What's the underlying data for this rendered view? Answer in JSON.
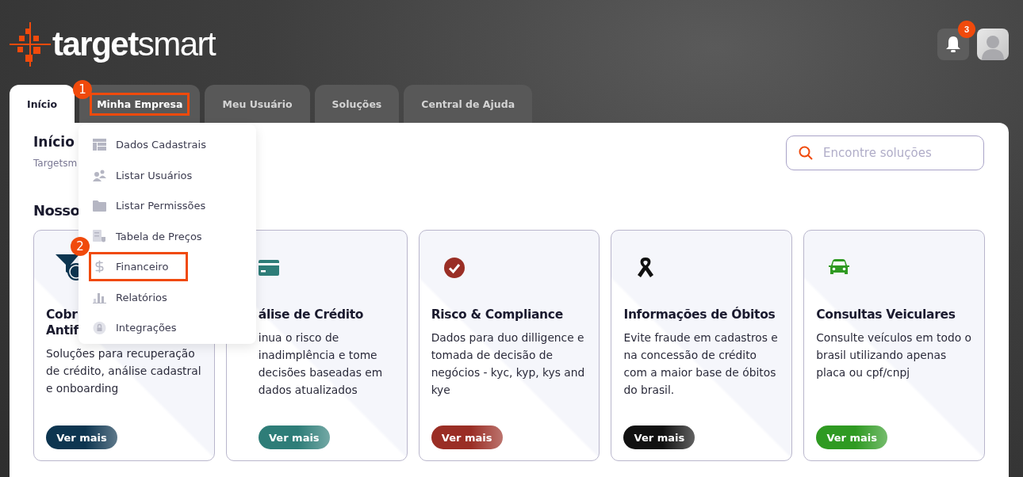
{
  "logo": {
    "bold": "target",
    "light": "smart"
  },
  "header": {
    "notifications": {
      "count": "3"
    }
  },
  "tabs": [
    {
      "label": "Início",
      "selected": true,
      "highlighted": false
    },
    {
      "label": "Minha Empresa",
      "selected": false,
      "highlighted": true,
      "marker": "1"
    },
    {
      "label": "Meu Usuário",
      "selected": false,
      "highlighted": false
    },
    {
      "label": "Soluções",
      "selected": false,
      "highlighted": false
    },
    {
      "label": "Central de Ajuda",
      "selected": false,
      "highlighted": false
    }
  ],
  "dropdown": {
    "items": [
      {
        "label": "Dados Cadastrais",
        "kind": "table",
        "highlighted": false
      },
      {
        "label": "Listar Usuários",
        "kind": "users",
        "highlighted": false
      },
      {
        "label": "Listar Permissões",
        "kind": "folder",
        "highlighted": false
      },
      {
        "label": "Tabela de Preços",
        "kind": "pricelist",
        "highlighted": false
      },
      {
        "label": "Financeiro",
        "kind": "dollar",
        "highlighted": true,
        "marker": "2"
      },
      {
        "label": "Relatórios",
        "kind": "chart",
        "highlighted": false
      },
      {
        "label": "Integrações",
        "kind": "lock",
        "highlighted": false
      }
    ]
  },
  "page": {
    "title": "Início",
    "breadcrumb": "Targetsm",
    "search": {
      "placeholder": "Encontre soluções"
    },
    "section_title": "Nosso"
  },
  "cards": [
    {
      "kind": "funnel",
      "title": [
        "Cobr",
        "Antif"
      ],
      "description": "Soluções para recuperação de crédito, análise cadastral e onboarding",
      "button": "Ver mais",
      "color": "#0d3550"
    },
    {
      "kind": "card",
      "title": [
        "álise de Crédito"
      ],
      "description": "inua o risco de inadimplência e tome decisões baseadas em dados atualizados",
      "button": "Ver mais",
      "color": "#2e7d78"
    },
    {
      "kind": "check",
      "title": [
        "Risco & Compliance"
      ],
      "description": "Dados para duo dilligence e tomada de decisão de negócios - kyc, kyp, kys and kye",
      "button": "Ver mais",
      "color": "#9a2e25"
    },
    {
      "kind": "ribbon",
      "title": [
        "Informações de Óbitos"
      ],
      "description": "Evite fraude em cadastros e na concessão de crédito com a maior base de óbitos do brasil.",
      "button": "Ver mais",
      "color": "#111111"
    },
    {
      "kind": "car",
      "title": [
        "Consultas Veiculares"
      ],
      "description": "Consulte veículos em todo o brasil utilizando apenas placa ou cpf/cnpj",
      "button": "Ver mais",
      "color": "#2f9a22"
    }
  ]
}
